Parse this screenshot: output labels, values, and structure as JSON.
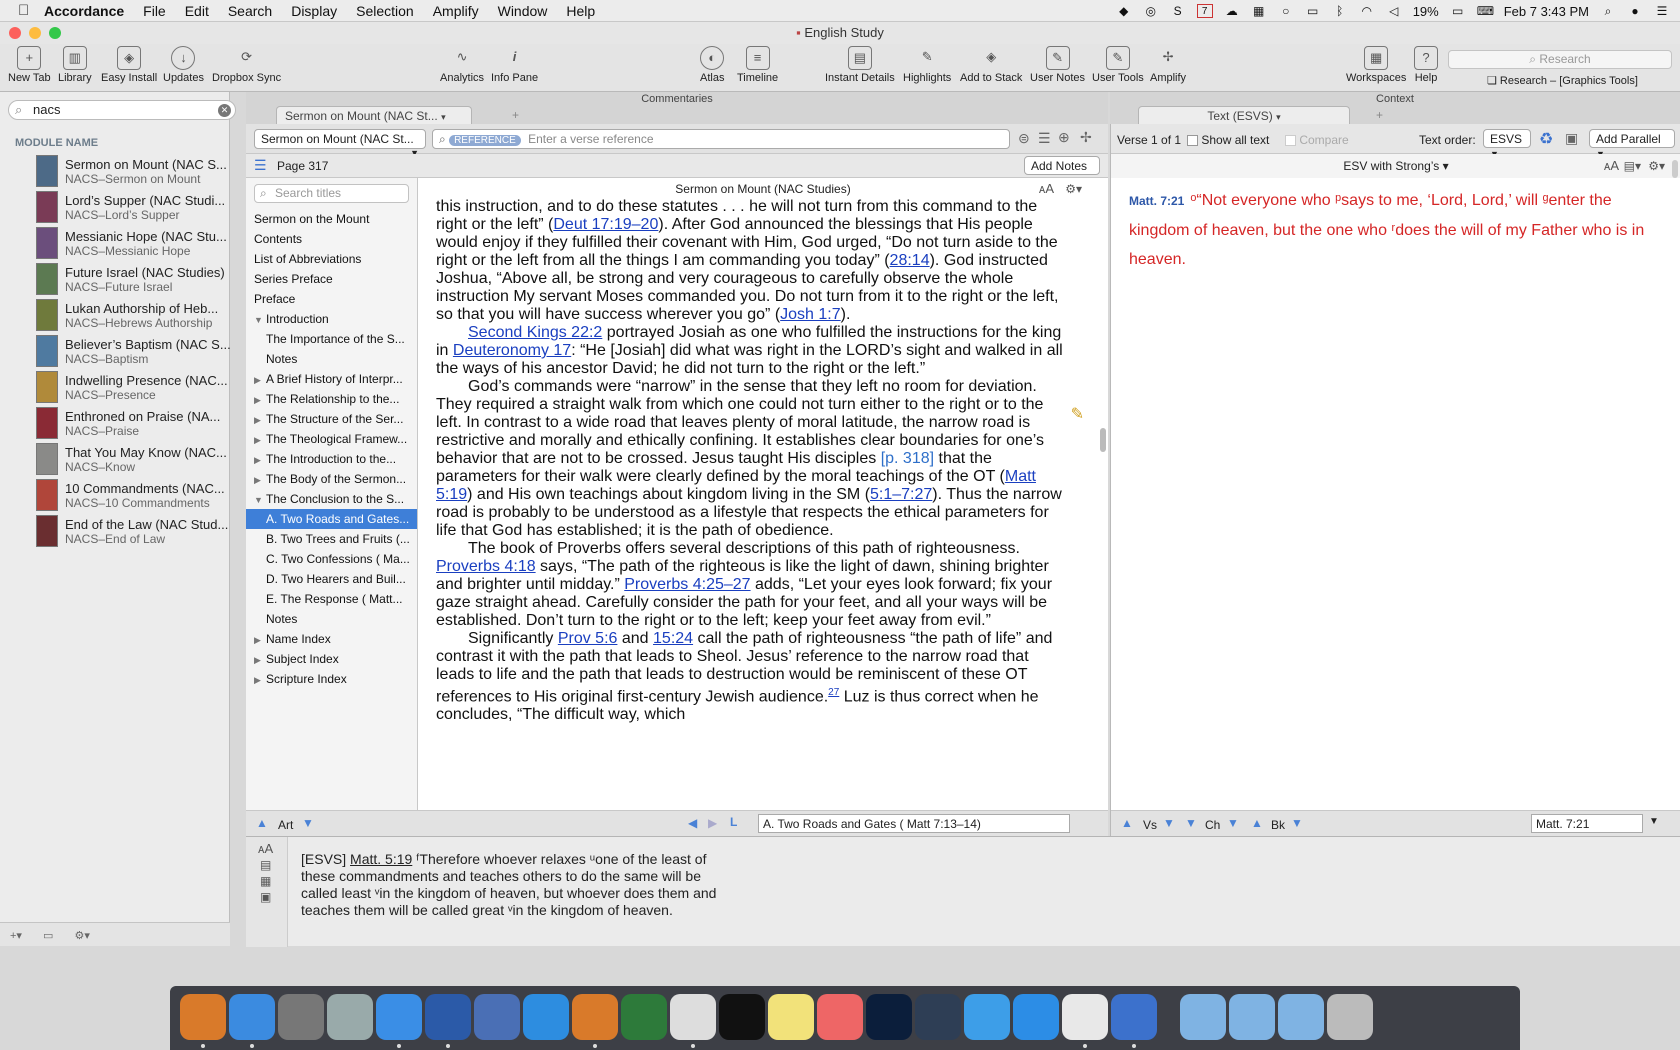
{
  "menubar": {
    "app": "Accordance",
    "items": [
      "File",
      "Edit",
      "Search",
      "Display",
      "Selection",
      "Amplify",
      "Window",
      "Help"
    ],
    "battery": "19%",
    "datetime": "Feb 7  3:43 PM",
    "calendar_day": "7"
  },
  "window": {
    "title": "English Study"
  },
  "toolbar": {
    "new_tab": "New Tab",
    "library": "Library",
    "easy_install": "Easy Install",
    "updates": "Updates",
    "dropbox_sync": "Dropbox Sync",
    "analytics": "Analytics",
    "info_pane": "Info Pane",
    "atlas": "Atlas",
    "timeline": "Timeline",
    "instant_details": "Instant Details",
    "highlights": "Highlights",
    "add_to_stack": "Add to Stack",
    "user_notes": "User Notes",
    "user_tools": "User Tools",
    "amplify": "Amplify",
    "workspaces": "Workspaces",
    "help": "Help",
    "research_placeholder": "Research",
    "research_label": "Research – [Graphics Tools]"
  },
  "left": {
    "search_value": "nacs",
    "module_heading": "MODULE NAME",
    "modules": [
      {
        "title": "Sermon on Mount (NAC S...",
        "abbr": "NACS–Sermon on Mount",
        "color": "#4d6a87"
      },
      {
        "title": "Lord’s Supper (NAC Studi...",
        "abbr": "NACS–Lord’s Supper",
        "color": "#7a3b56"
      },
      {
        "title": "Messianic Hope (NAC Stu...",
        "abbr": "NACS–Messianic Hope",
        "color": "#6b4e7c"
      },
      {
        "title": "Future Israel (NAC Studies)",
        "abbr": "NACS–Future Israel",
        "color": "#5c7a52"
      },
      {
        "title": "Lukan Authorship of Heb...",
        "abbr": "NACS–Hebrews Authorship",
        "color": "#6f7a3c"
      },
      {
        "title": "Believer’s Baptism (NAC S...",
        "abbr": "NACS–Baptism",
        "color": "#4f7aa0"
      },
      {
        "title": "Indwelling Presence (NAC...",
        "abbr": "NACS–Presence",
        "color": "#b08a3a"
      },
      {
        "title": "Enthroned on Praise (NA...",
        "abbr": "NACS–Praise",
        "color": "#8a2a35"
      },
      {
        "title": "That You May Know (NAC...",
        "abbr": "NACS–Know",
        "color": "#8a8a88"
      },
      {
        "title": "10 Commandments (NAC...",
        "abbr": "NACS–10 Commandments",
        "color": "#b0463a"
      },
      {
        "title": "End of the Law (NAC Stud...",
        "abbr": "NACS–End of Law",
        "color": "#6a2e30"
      }
    ]
  },
  "commentaries": {
    "pane_header": "Commentaries",
    "tab_label": "Sermon on Mount (NAC St...",
    "module_popup": "Sermon on Mount (NAC St...",
    "search_mode": "REFERENCE",
    "search_placeholder": "Enter a verse reference",
    "page_label": "Page 317",
    "add_notes": "Add Notes",
    "toc_placeholder": "Search titles",
    "text_header": "Sermon on Mount (NAC Studies)",
    "art_label": "Art",
    "location": "A. Two Roads and Gates ( Matt 7:13–14)",
    "toc": [
      {
        "label": "Sermon on the Mount",
        "indent": 0,
        "tri": ""
      },
      {
        "label": "Contents",
        "indent": 0,
        "tri": ""
      },
      {
        "label": "List of Abbreviations",
        "indent": 0,
        "tri": ""
      },
      {
        "label": "Series Preface",
        "indent": 0,
        "tri": ""
      },
      {
        "label": "Preface",
        "indent": 0,
        "tri": ""
      },
      {
        "label": "Introduction",
        "indent": 0,
        "tri": "▼"
      },
      {
        "label": "The Importance of the S...",
        "indent": 1,
        "tri": ""
      },
      {
        "label": "Notes",
        "indent": 1,
        "tri": ""
      },
      {
        "label": "A Brief History of Interpr...",
        "indent": 0,
        "tri": "▶"
      },
      {
        "label": "The Relationship to the...",
        "indent": 0,
        "tri": "▶"
      },
      {
        "label": "The Structure of the Ser...",
        "indent": 0,
        "tri": "▶"
      },
      {
        "label": "The Theological Framew...",
        "indent": 0,
        "tri": "▶"
      },
      {
        "label": "The Introduction to the...",
        "indent": 0,
        "tri": "▶"
      },
      {
        "label": "The Body of the Sermon...",
        "indent": 0,
        "tri": "▶"
      },
      {
        "label": "The Conclusion to the S...",
        "indent": 0,
        "tri": "▼"
      },
      {
        "label": "A. Two Roads and Gates...",
        "indent": 1,
        "tri": "",
        "selected": true
      },
      {
        "label": "B. Two Trees and Fruits (...",
        "indent": 1,
        "tri": ""
      },
      {
        "label": "C. Two Confessions ( Ma...",
        "indent": 1,
        "tri": ""
      },
      {
        "label": "D. Two Hearers and Buil...",
        "indent": 1,
        "tri": ""
      },
      {
        "label": "E. The Response ( Matt...",
        "indent": 1,
        "tri": ""
      },
      {
        "label": "Notes",
        "indent": 1,
        "tri": ""
      },
      {
        "label": "Name Index",
        "indent": 0,
        "tri": "▶"
      },
      {
        "label": "Subject Index",
        "indent": 0,
        "tri": "▶"
      },
      {
        "label": "Scripture Index",
        "indent": 0,
        "tri": "▶"
      }
    ],
    "text": {
      "p0a": "this instruction, and to do these statutes . . . he will not turn from this command to the right or the left” (",
      "l_deut": "Deut 17:19–20",
      "p0b": "). After God announced the blessings that His people would enjoy if they fulfilled their covenant with Him, God urged, “Do not turn aside to the right or the left from all the things I am commanding you today” (",
      "l_2814": "28:14",
      "p0c": "). God instructed Joshua, “Above all, be strong and very courageous to carefully observe the whole instruction My servant Moses commanded you. Do not turn from it to the right or the left, so that you will have success wherever you go” (",
      "l_josh": "Josh 1:7",
      "p0d": ").",
      "l_2kings": "Second Kings 22:2",
      "p1a": " portrayed Josiah as one who fulfilled the instructions for the king in ",
      "l_deut17": "Deuteronomy 17",
      "p1b": ": “He [Josiah] did what was right in the LORD’s sight and walked in all the ways of his ancestor David; he did not turn to the right or the left.”",
      "p2a": "God’s commands were “narrow” in the sense that they left no room for deviation. They required a straight walk from which one could not turn either to the right or to the left. In contrast to a wide road that leaves plenty of moral latitude, the narrow road is restrictive and morally and ethically confining. It establishes clear boundaries for one’s behavior that are not to be crossed. Jesus taught His disciples ",
      "pagemark": "[p. 318]",
      "p2b": " that the parameters for their walk were clearly defined by the moral teachings of the OT (",
      "l_matt519": "Matt 5:19",
      "p2c": ") and His own teachings about kingdom living in the SM (",
      "l_51727": "5:1–7:27",
      "p2d": "). Thus the narrow road is probably to be understood as a lifestyle that respects the ethical parameters for life that God has established; it is the path of obedience.",
      "p3a": "The book of Proverbs offers several descriptions of this path of righteousness. ",
      "l_prov418": "Proverbs 4:18",
      "p3b": " says, “The path of the righteous is like the light of dawn, shining brighter and brighter until midday.” ",
      "l_prov425": "Proverbs 4:25–27",
      "p3c": " adds, “Let your eyes look forward; fix your gaze straight ahead. Carefully consider the path for your feet, and all your ways will be established. Don’t turn to the right or to the left; keep your feet away from evil.”",
      "p4a": "Significantly ",
      "l_prov56": "Prov 5:6",
      "p4and": " and ",
      "l_1524": "15:24",
      "p4b": " call the path of righteousness “the path of life” and contrast it with the path that leads to Sheol. Jesus’ reference to the narrow road that leads to life and the path that leads to destruction would be reminiscent of these OT references to His original first-century Jewish audience.",
      "fn": "27",
      "p4c": " Luz is thus correct when he concludes, “The difficult way, which"
    }
  },
  "context": {
    "pane_header": "Context",
    "tab_label": "Text (ESVS)",
    "verse_count": "Verse 1 of 1",
    "show_all_text": "Show all text",
    "compare": "Compare",
    "text_order_label": "Text order:",
    "text_order_value": "ESVS",
    "add_parallel": "Add Parallel",
    "module_name": "ESV with Strong’s",
    "verse_ref": "Matt. 7:21",
    "verse_text": "ᵒ“Not everyone who ᵖsays to me, ‘Lord, Lord,’ will ᵍenter the kingdom of heaven, but the one who ʳdoes the will of my Father who is in heaven.",
    "nav_vs": "Vs",
    "nav_ch": "Ch",
    "nav_bk": "Bk",
    "ref_field": "Matt. 7:21"
  },
  "instant": {
    "module": "[ESVS]",
    "ref": "Matt. 5:19",
    "text": " ᶠTherefore whoever relaxes ᵘone of the least of these commandments and teaches others to do the same will be called least ᵛin the kingdom of heaven, but whoever does them and teaches them will be called great ᵛin the kingdom of heaven."
  },
  "dock": {
    "icons": [
      "accordance",
      "finder",
      "system-preferences",
      "launchpad",
      "safari",
      "word",
      "keynote",
      "support",
      "accordance-2",
      "book-app",
      "scrivener",
      "scrivener-s",
      "notes",
      "photos",
      "photoshop",
      "layers-app",
      "messages",
      "app-store",
      "chrome",
      "scrivener-3",
      "applications-folder",
      "documents-folder",
      "downloads-folder",
      "trash"
    ]
  }
}
